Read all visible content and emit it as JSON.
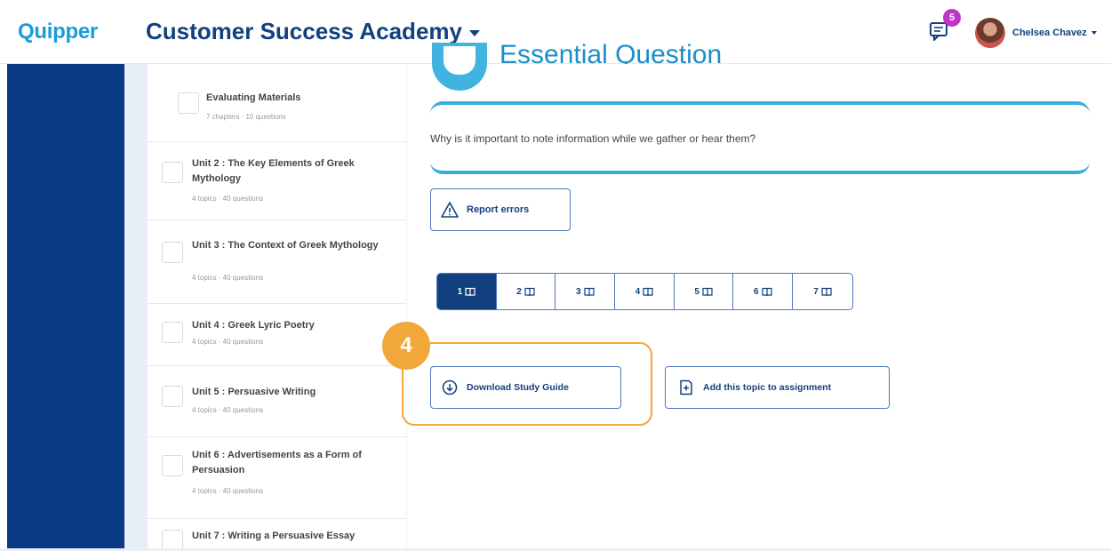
{
  "header": {
    "logo": "Quipper",
    "course_title": "Customer Success Academy",
    "notification_count": "5",
    "user_name": "Chelsea Chavez"
  },
  "topics": [
    {
      "title": "Evaluating Materials",
      "meta": "7 chapters · 10 questions"
    },
    {
      "title": "Unit 2 : The Key Elements of Greek Mythology",
      "meta": "4 topics · 40 questions"
    },
    {
      "title": "Unit 3 : The Context of Greek Mythology",
      "meta": "4 topics · 40 questions"
    },
    {
      "title": "Unit 4 : Greek Lyric Poetry",
      "meta": "4 topics · 40 questions"
    },
    {
      "title": "Unit 5 : Persuasive Writing",
      "meta": "4 topics · 40 questions"
    },
    {
      "title": "Unit 6 : Advertisements as a Form of Persuasion",
      "meta": "4 topics · 40 questions"
    },
    {
      "title": "Unit 7 : Writing a Persuasive Essay",
      "meta": ""
    }
  ],
  "main": {
    "section_title": "Essential Question",
    "question": "Why is it important to note information while we gather or hear them?",
    "report_label": "Report errors",
    "chapter_tabs": [
      "1",
      "2",
      "3",
      "4",
      "5",
      "6",
      "7"
    ],
    "active_tab": "1",
    "step_number": "4",
    "download_label": "Download Study Guide",
    "add_label": "Add this topic to assignment"
  },
  "colors": {
    "navy": "#0b3a86",
    "brand_blue": "#1a9cd8",
    "accent_orange": "#f2a73b",
    "badge_purple": "#c234c8"
  }
}
